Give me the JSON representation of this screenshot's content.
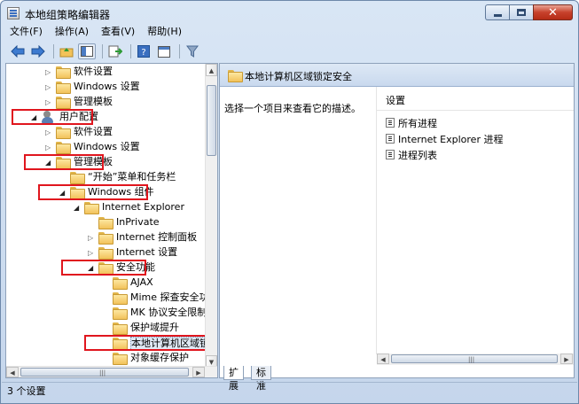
{
  "window": {
    "title": "本地组策略编辑器",
    "controls": {
      "minimize": "minimize",
      "maximize": "maximize",
      "close": "close"
    }
  },
  "menu": [
    "文件(F)",
    "操作(A)",
    "查看(V)",
    "帮助(H)"
  ],
  "toolbar": [
    "back-arrow-icon",
    "forward-arrow-icon",
    "up-folder-icon",
    "show-hide-tree-icon",
    "export-list-icon",
    "help-icon",
    "properties-icon",
    "filter-icon"
  ],
  "tree": {
    "items": [
      {
        "label": "软件设置",
        "expander": "collapsed",
        "icon": "folder"
      },
      {
        "label": "Windows 设置",
        "expander": "collapsed",
        "icon": "folder"
      },
      {
        "label": "管理模板",
        "expander": "collapsed",
        "icon": "folder"
      },
      {
        "label": "用户配置",
        "expander": "expanded",
        "icon": "user",
        "highlighted": true
      },
      {
        "label": "软件设置",
        "expander": "collapsed",
        "icon": "folder"
      },
      {
        "label": "Windows 设置",
        "expander": "collapsed",
        "icon": "folder"
      },
      {
        "label": "管理模板",
        "expander": "expanded",
        "icon": "folder",
        "highlighted": true
      },
      {
        "label": "“开始”菜单和任务栏",
        "expander": "none",
        "icon": "folder"
      },
      {
        "label": "Windows 组件",
        "expander": "expanded",
        "icon": "folder",
        "highlighted": true
      },
      {
        "label": "Internet Explorer",
        "expander": "expanded",
        "icon": "folder"
      },
      {
        "label": "InPrivate",
        "expander": "none",
        "icon": "folder"
      },
      {
        "label": "Internet 控制面板",
        "expander": "collapsed",
        "icon": "folder"
      },
      {
        "label": "Internet 设置",
        "expander": "collapsed",
        "icon": "folder"
      },
      {
        "label": "安全功能",
        "expander": "expanded",
        "icon": "folder",
        "highlighted": true
      },
      {
        "label": "AJAX",
        "expander": "none",
        "icon": "folder"
      },
      {
        "label": "Mime 探查安全功能",
        "expander": "none",
        "icon": "folder"
      },
      {
        "label": "MK 协议安全限制",
        "expander": "none",
        "icon": "folder"
      },
      {
        "label": "保护域提升",
        "expander": "none",
        "icon": "folder"
      },
      {
        "label": "本地计算机区域锁定安",
        "expander": "none",
        "icon": "folder",
        "highlighted": true,
        "selected": true
      },
      {
        "label": "对象缓存保护",
        "expander": "none",
        "icon": "folder"
      }
    ]
  },
  "details": {
    "header": "本地计算机区域锁定安全",
    "description": "选择一个项目来查看它的描述。",
    "column": "设置",
    "items": [
      "所有进程",
      "Internet Explorer 进程",
      "进程列表"
    ]
  },
  "tabs": [
    "扩展",
    "标准"
  ],
  "status": "3 个设置",
  "colors": {
    "highlight_box": "#e0161e",
    "window_frame": "#c5d6ec",
    "pane_header": "#dde8f5"
  }
}
